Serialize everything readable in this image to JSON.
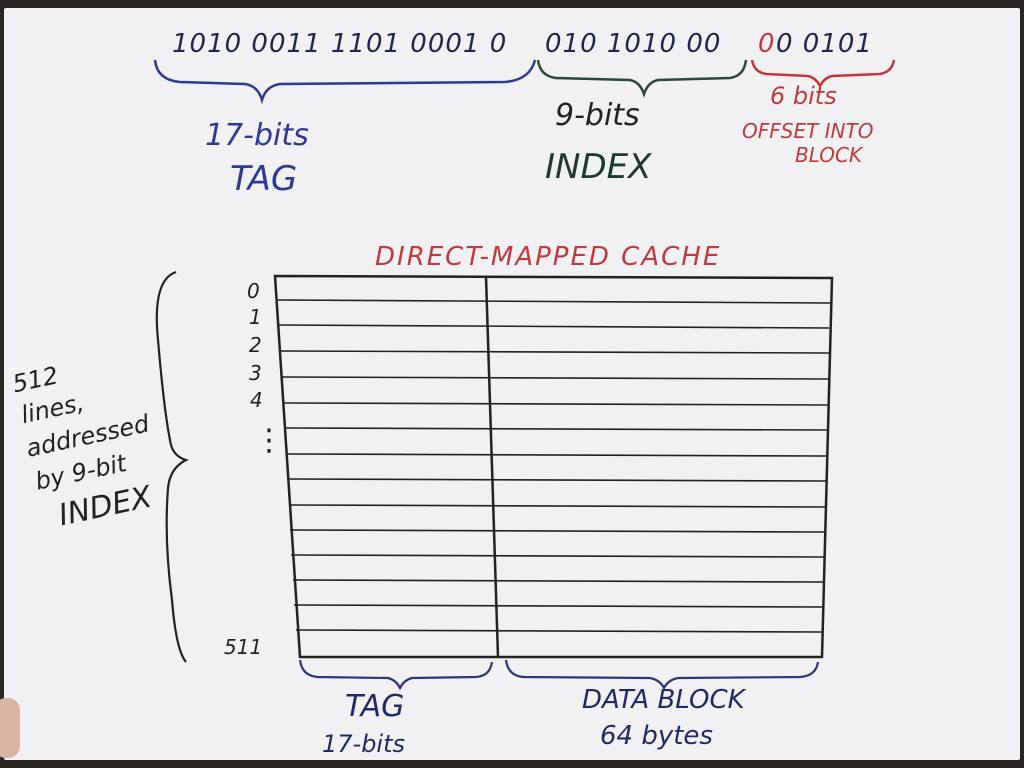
{
  "address": {
    "tag_bits": "1010 0011 1101 0001 0",
    "index_bits": "010 1010 00",
    "offset_bits_red": "0",
    "offset_bits_rest": "0 0101"
  },
  "fields": {
    "tag": {
      "bits_label": "17-bits",
      "name": "TAG"
    },
    "index": {
      "bits_label": "9-bits",
      "name": "INDEX"
    },
    "offset": {
      "bits_label": "6 bits",
      "name_line1": "OFFSET INTO",
      "name_line2": "BLOCK"
    }
  },
  "cache": {
    "title": "DIRECT-MAPPED CACHE",
    "row_labels": [
      "0",
      "1",
      "2",
      "3",
      "4"
    ],
    "ellipsis": "⋮",
    "last_row_label": "511",
    "side_note": [
      "512",
      "lines,",
      "addressed",
      "by 9-bit",
      "INDEX"
    ],
    "tag_column": {
      "line1": "TAG",
      "line2": "17-bits"
    },
    "data_column": {
      "line1": "DATA BLOCK",
      "line2": "64 bytes"
    }
  },
  "colors": {
    "tag": "#2c3a96",
    "index": "#1d3a2a",
    "offset": "#c2393b",
    "table_ink": "#222222"
  }
}
